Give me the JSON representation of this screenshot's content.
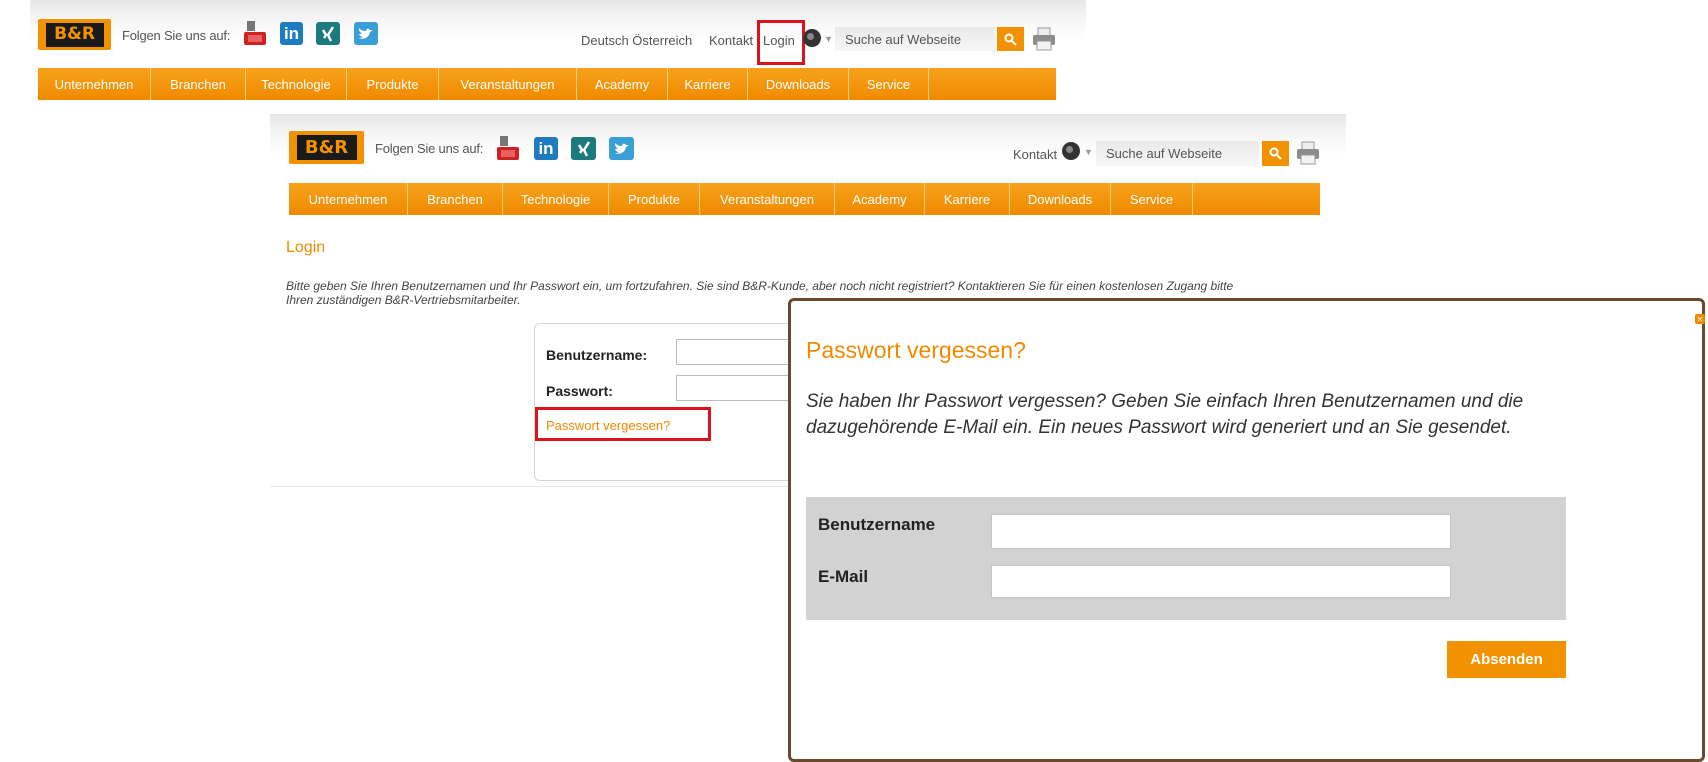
{
  "header": {
    "follow_label": "Folgen Sie uns auf:",
    "language_label": "Deutsch Österreich",
    "contact_label": "Kontakt",
    "login_label": "Login",
    "search_placeholder": "Suche auf Webseite",
    "brand_color": "#f39200"
  },
  "social": {
    "youtube_icon": "youtube-icon",
    "linkedin_text": "in",
    "xing_icon": "xing-icon",
    "twitter_icon": "twitter-icon"
  },
  "nav": {
    "items": [
      "Unternehmen",
      "Branchen",
      "Technologie",
      "Produkte",
      "Veranstaltungen",
      "Academy",
      "Karriere",
      "Downloads",
      "Service"
    ]
  },
  "login_page": {
    "title": "Login",
    "intro_line1": "Bitte geben Sie Ihren Benutzernamen und Ihr Passwort ein, um fortzufahren. Sie sind B&R-Kunde, aber noch nicht registriert? Kontaktieren Sie für einen kostenlosen Zugang bitte",
    "intro_line2": "Ihren zuständigen B&R-Vertriebsmitarbeiter.",
    "username_label": "Benutzername:",
    "password_label": "Passwort:",
    "forgot_link": "Passwort vergessen?"
  },
  "dialog": {
    "title": "Passwort vergessen?",
    "text": "Sie haben Ihr Passwort vergessen? Geben Sie einfach Ihren Benutzernamen und die dazugehörende E-Mail ein. Ein neues Passwort wird generiert und an Sie gesendet.",
    "username_label": "Benutzername",
    "email_label": "E-Mail",
    "submit_label": "Absenden"
  }
}
